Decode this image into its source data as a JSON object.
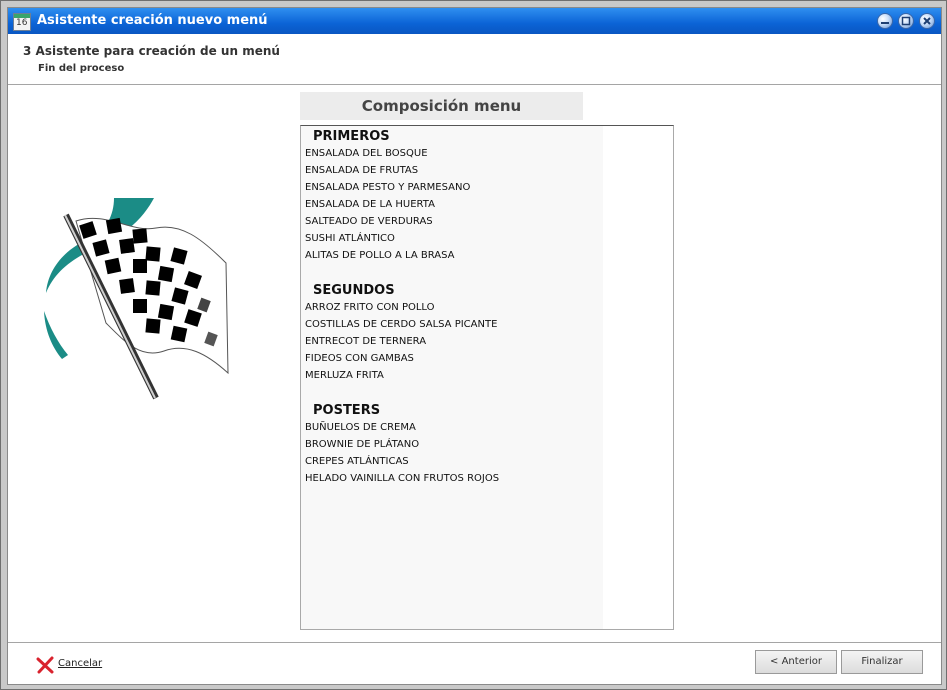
{
  "window": {
    "title": "Asistente creación nuevo menú",
    "icon": "calendar-icon",
    "icon_text": "16",
    "controls": [
      "minimize-icon",
      "restore-icon",
      "close-icon"
    ]
  },
  "step": {
    "title": "3 Asistente para creación de un menú",
    "subtitle": "Fin del proceso"
  },
  "illustration": "checkered-flag-icon",
  "composition": {
    "title": "Composición menu",
    "sections": [
      {
        "heading": "PRIMEROS",
        "items": [
          "ENSALADA DEL BOSQUE",
          "ENSALADA DE FRUTAS",
          "ENSALADA PESTO Y PARMESANO",
          "ENSALADA DE LA HUERTA",
          "SALTEADO DE VERDURAS",
          "SUSHI ATLÁNTICO",
          "ALITAS DE POLLO A LA BRASA"
        ]
      },
      {
        "heading": "SEGUNDOS",
        "items": [
          "ARROZ FRITO CON POLLO",
          "COSTILLAS DE CERDO SALSA PICANTE",
          "ENTRECOT DE TERNERA",
          "FIDEOS CON GAMBAS",
          "MERLUZA FRITA"
        ]
      },
      {
        "heading": "POSTERS",
        "items": [
          "BUÑUELOS DE CREMA",
          "BROWNIE DE PLÁTANO",
          "CREPES ATLÁNTICAS",
          "HELADO VAINILLA CON FRUTOS ROJOS"
        ]
      }
    ]
  },
  "footer": {
    "cancel_label": "Cancelar",
    "cancel_icon": "cancel-x-icon",
    "previous_label": "< Anterior",
    "finish_label": "Finalizar"
  },
  "colors": {
    "titlebar": "#0b63d6",
    "flag_teal": "#1b8c86",
    "cancel_red": "#d9232e"
  }
}
